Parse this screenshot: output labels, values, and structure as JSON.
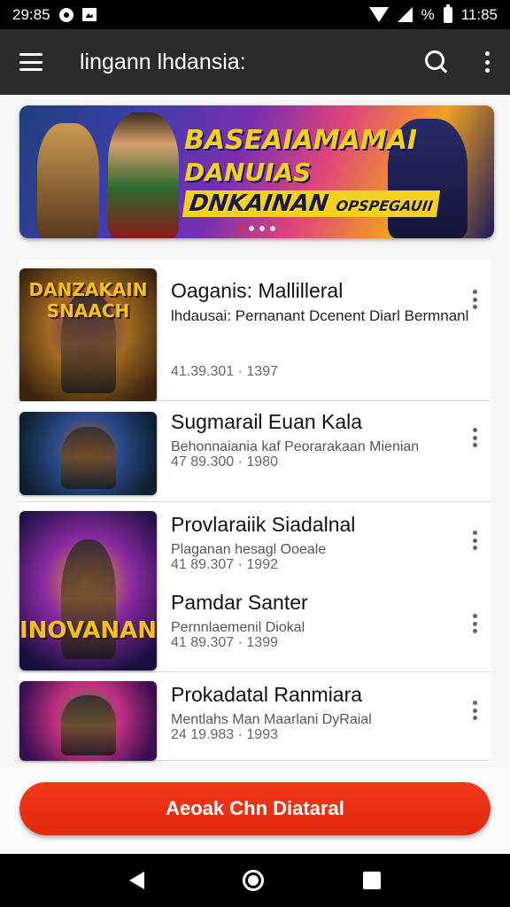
{
  "status_bar": {
    "time_left": "29:85",
    "battery_text": "%",
    "time_right": "11:85"
  },
  "app_bar": {
    "title": "lingann lhdansia:"
  },
  "banner": {
    "line1": "BASEAIAMAMAI",
    "line2": "DANUIAS",
    "line3": "DNKAINAN",
    "line3_small": "OPSPEGAUII",
    "dots": 4,
    "active_dot": 0
  },
  "games": [
    {
      "title": "Oaganis: Mallilleral",
      "subtitle": "lhdausai: Pernanant Dcenent Diarl Bermnanl",
      "meta": "41.39.301 · 1397",
      "thumb_logo": "DANZAKAIN SNAACH",
      "thumb_colors": [
        "#3a2410",
        "#a06a20",
        "#6a2a8a"
      ]
    },
    {
      "title": "Sugmarail Euan Kala",
      "subtitle": "Behonnaiania kaf Peorarakaan Mienian",
      "meta": "47 89.300 · 1980",
      "thumb_logo": "",
      "thumb_colors": [
        "#0f2030",
        "#2a4a8a",
        "#d06020"
      ]
    },
    {
      "title": "Provlaraiik Siadalnal",
      "subtitle": "Plaganan hesagl Ooeale",
      "meta": "41 89.307 · 1992",
      "thumb_logo": "",
      "thumb_colors": [
        "#1a1040",
        "#8a2aa0",
        "#f0a030"
      ]
    },
    {
      "title": "Pamdar Santer",
      "subtitle": "Pernnlaemenil Diokal",
      "meta": "41 89.307 · 1399",
      "thumb_logo": "INOVANANI",
      "thumb_colors": [
        "#1a1040",
        "#8a2aa0",
        "#f0a030"
      ]
    },
    {
      "title": "Prokadatal Ranmiara",
      "subtitle": "Mentlahs Man Maarlani DyRaial",
      "meta": "24 19.983 · 1993",
      "thumb_logo": "",
      "thumb_colors": [
        "#3a1050",
        "#c03080",
        "#3a8a3a"
      ]
    }
  ],
  "cta": {
    "label": "Aeoak Chn Diataral"
  }
}
